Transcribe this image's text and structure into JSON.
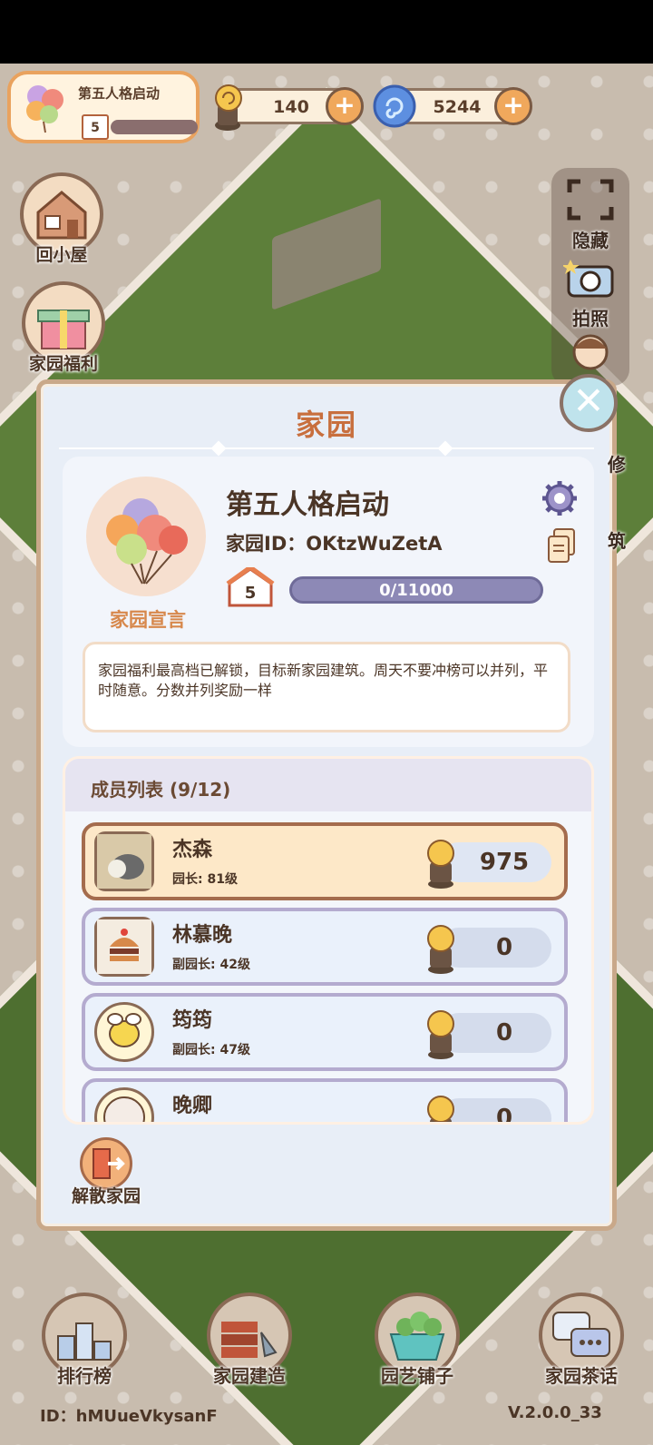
{
  "hud": {
    "garden_name": "第五人格启动",
    "garden_level": "5",
    "currency_snail": "140",
    "currency_swirl": "5244"
  },
  "side": {
    "home_label": "回小屋",
    "welfare_label": "家园福利",
    "hide_label": "隐藏",
    "photo_label": "拍照",
    "decor_label": "修",
    "build_label": "筑"
  },
  "dialog": {
    "title": "家园",
    "garden_name": "第五人格启动",
    "garden_id": "家园ID：OKtzWuZetA",
    "level": "5",
    "exp": "0/11000",
    "declaration_label": "家园宣言",
    "declaration_text": "家园福利最高档已解锁，目标新家园建筑。周天不要冲榜可以并列，平时随意。分数并列奖励一样",
    "members_title": "成员列表 (9/12)",
    "members": [
      {
        "name": "杰森",
        "role": "园长: 81级",
        "score": "975",
        "highlight": true
      },
      {
        "name": "林慕晚",
        "role": "副园长: 42级",
        "score": "0",
        "highlight": false
      },
      {
        "name": "筠筠",
        "role": "副园长: 47级",
        "score": "0",
        "highlight": false
      },
      {
        "name": "晚卿",
        "role": "",
        "score": "0",
        "highlight": false
      }
    ],
    "dissolve_label": "解散家园"
  },
  "nav": {
    "ranking": "排行榜",
    "build": "家园建造",
    "shop": "园艺铺子",
    "chat": "家园茶话"
  },
  "footer": {
    "id": "ID：hMUueVkysanF",
    "version": "V.2.0.0_33"
  }
}
